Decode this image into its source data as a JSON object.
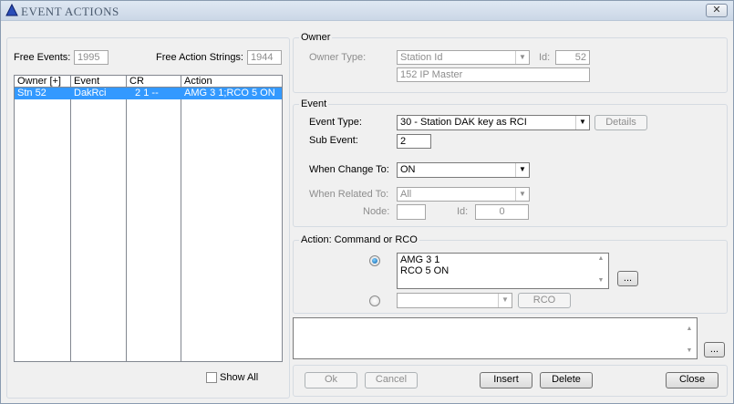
{
  "window": {
    "title": "EVENT ACTIONS",
    "close": "✕"
  },
  "left": {
    "free_events_label": "Free Events:",
    "free_events": "1995",
    "free_action_strings_label": "Free Action Strings:",
    "free_action_strings": "1944",
    "columns": [
      "Owner [+]",
      "Event",
      "CR",
      "Action"
    ],
    "rows": [
      {
        "owner": "Stn 52",
        "event": "DakRci",
        "cr": " 2 1 --",
        "action": "AMG 3 1;RCO 5 ON"
      }
    ],
    "show_all_label": "Show All"
  },
  "owner": {
    "legend": "Owner",
    "type_label": "Owner Type:",
    "type_value": "Station Id",
    "id_label": "Id:",
    "id_value": "52",
    "name": "152 IP Master"
  },
  "event": {
    "legend": "Event",
    "type_label": "Event Type:",
    "type_value": "30 - Station DAK key as RCI",
    "details": "Details",
    "sub_label": "Sub Event:",
    "sub_value": "2",
    "change_label": "When Change To:",
    "change_value": "ON",
    "related_label": "When Related To:",
    "related_value": "All",
    "node_label": "Node:",
    "node_value": "",
    "id_label": "Id:",
    "id_value": "0"
  },
  "action": {
    "legend": "Action: Command or RCO",
    "command_lines": [
      "AMG 3 1",
      "RCO 5 ON"
    ],
    "ellipsis": "...",
    "rco_value": "",
    "rco_button": "RCO"
  },
  "notes": {
    "value": "",
    "ellipsis": "..."
  },
  "buttons": {
    "ok": "Ok",
    "cancel": "Cancel",
    "insert": "Insert",
    "delete": "Delete",
    "close": "Close"
  }
}
